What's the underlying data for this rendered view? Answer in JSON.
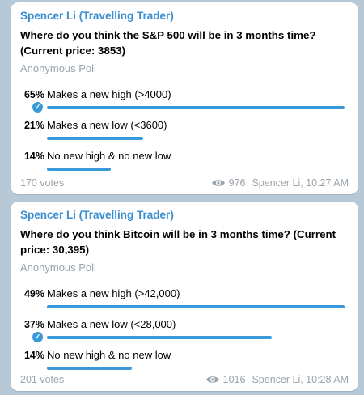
{
  "polls": [
    {
      "sender": "Spencer Li (Travelling Trader)",
      "question_line1": "Where do you think the S&P 500 will be in 3 months time?",
      "question_line2": "(Current price: 3853)",
      "kind": "Anonymous Poll",
      "options": [
        {
          "pct": "65%",
          "text": "Makes a new high (>4000)",
          "fraction": 0.65,
          "chosen": true
        },
        {
          "pct": "21%",
          "text": "Makes a new low (<3600)",
          "fraction": 0.21,
          "chosen": false
        },
        {
          "pct": "14%",
          "text": "No new high & no new low",
          "fraction": 0.14,
          "chosen": false
        }
      ],
      "votes": "170 votes",
      "views": "976",
      "meta": "Spencer Li, 10:27 AM"
    },
    {
      "sender": "Spencer Li (Travelling Trader)",
      "question_line1": "Where do you think Bitcoin will be in 3 months time? (Current",
      "question_line2": "price: 30,395)",
      "kind": "Anonymous Poll",
      "options": [
        {
          "pct": "49%",
          "text": "Makes a new high (>42,000)",
          "fraction": 0.49,
          "chosen": false
        },
        {
          "pct": "37%",
          "text": "Makes a new low (<28,000)",
          "fraction": 0.37,
          "chosen": true
        },
        {
          "pct": "14%",
          "text": "No new high & no new low",
          "fraction": 0.14,
          "chosen": false
        }
      ],
      "votes": "201 votes",
      "views": "1016",
      "meta": "Spencer Li, 10:28 AM"
    }
  ],
  "colors": {
    "accent": "#3a9ad9",
    "sender": "#3a8fd0",
    "muted": "#9aa3ab",
    "background": "#b7c9d6"
  },
  "icons": {
    "views": "eye-icon",
    "chosen": "check-circle-icon"
  }
}
